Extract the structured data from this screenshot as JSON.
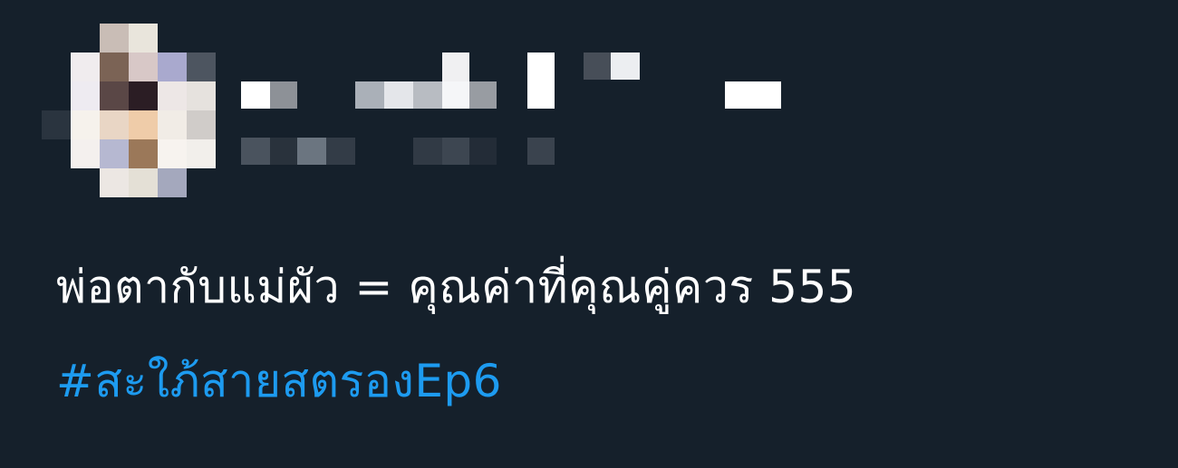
{
  "tweet": {
    "author": {
      "avatar_state": "pixelated",
      "display_name_state": "pixelated",
      "handle_state": "pixelated"
    },
    "text": "พ่อตากับแม่ผัว = คุณค่าที่คุณคู่ควร 555",
    "hashtag": "#สะใภ้สายสตรองEp6",
    "colors": {
      "background": "#15202b",
      "text": "#ffffff",
      "hashtag": "#1d9bf0"
    }
  }
}
